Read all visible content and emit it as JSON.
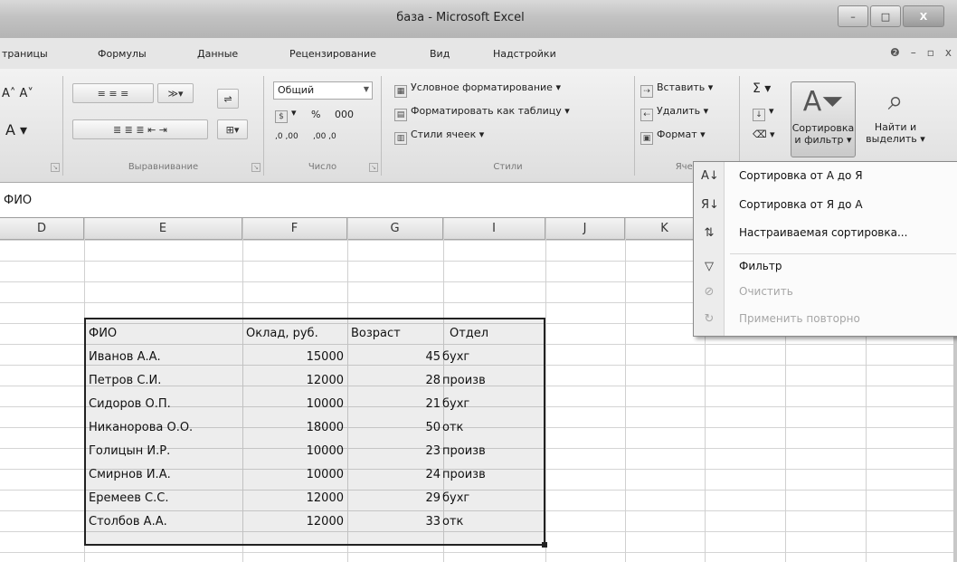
{
  "window": {
    "title": "база - Microsoft Excel",
    "controls": [
      "–",
      "□",
      "X"
    ]
  },
  "tabs": [
    "траницы",
    "Формулы",
    "Данные",
    "Рецензирование",
    "Вид",
    "Надстройки"
  ],
  "ribbon": {
    "alignment_label": "Выравнивание",
    "number": {
      "format": "Общий",
      "percent": "%",
      "thousands": "000",
      "inc": ",0 ,00",
      "dec": ",00 ,0",
      "label": "Число"
    },
    "styles": {
      "cond_format": "Условное форматирование",
      "as_table": "Форматировать как таблицу",
      "cell_styles": "Стили ячеек",
      "label": "Стили"
    },
    "cells": {
      "insert": "Вставить",
      "delete": "Удалить",
      "format": "Формат",
      "label": "Ячей"
    },
    "editing": {
      "sort_line1": "Сортировка",
      "sort_line2": "и фильтр",
      "find_line1": "Найти и",
      "find_line2": "выделить"
    }
  },
  "formula_bar": {
    "value": "ФИО"
  },
  "columns": [
    "D",
    "E",
    "F",
    "G",
    "I",
    "J",
    "K"
  ],
  "table": {
    "headers": [
      "ФИО",
      "Оклад, руб.",
      "Возраст",
      "Отдел"
    ],
    "rows": [
      [
        "Иванов А.А.",
        "15000",
        "45",
        "бухг"
      ],
      [
        "Петров С.И.",
        "12000",
        "28",
        "произв"
      ],
      [
        "Сидоров О.П.",
        "10000",
        "21",
        "бухг"
      ],
      [
        "Никанорова О.О.",
        "18000",
        "50",
        "отк"
      ],
      [
        "Голицын И.Р.",
        "10000",
        "23",
        "произв"
      ],
      [
        "Смирнов И.А.",
        "10000",
        "24",
        "произв"
      ],
      [
        "Еремеев С.С.",
        "12000",
        "29",
        "бухг"
      ],
      [
        "Столбов А.А.",
        "12000",
        "33",
        "отк"
      ]
    ]
  },
  "sort_menu": {
    "items": [
      {
        "label": "Сортировка от А до Я",
        "icon": "sort-asc-icon",
        "glyph": "А↓"
      },
      {
        "label": "Сортировка от Я до А",
        "icon": "sort-desc-icon",
        "glyph": "Я↓"
      },
      {
        "label": "Настраиваемая сортировка...",
        "icon": "custom-sort-icon",
        "glyph": "⇅"
      },
      {
        "label": "Фильтр",
        "icon": "filter-icon",
        "glyph": "▽"
      },
      {
        "label": "Очистить",
        "icon": "clear-filter-icon",
        "glyph": "⊘"
      },
      {
        "label": "Применить повторно",
        "icon": "reapply-icon",
        "glyph": "↻"
      }
    ]
  }
}
